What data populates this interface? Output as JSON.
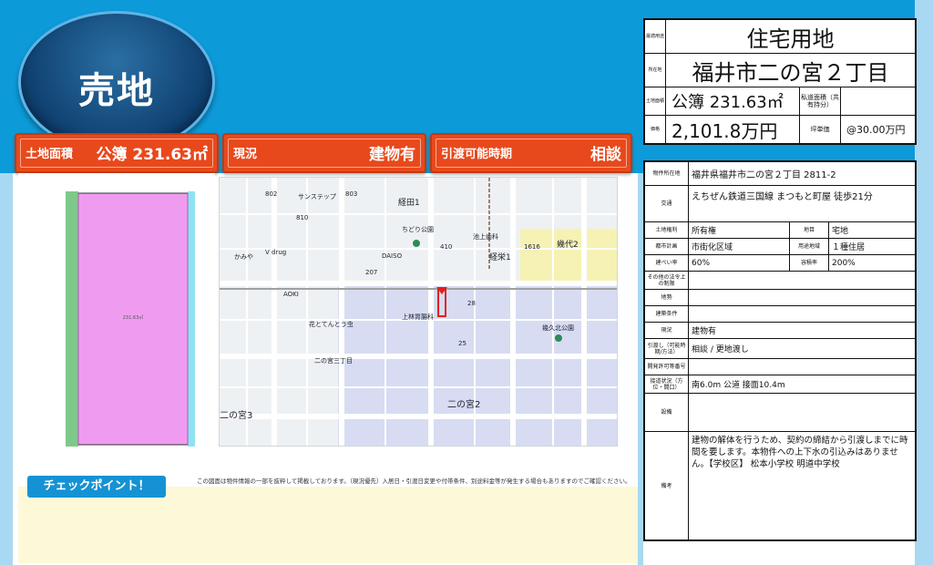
{
  "header": {
    "badge": "売地",
    "pills": [
      {
        "label": "土地面積",
        "value": "公簿 231.63㎡"
      },
      {
        "label": "現況",
        "value": "建物有"
      },
      {
        "label": "引渡可能時期",
        "value": "相談"
      }
    ]
  },
  "summary": {
    "use_label": "最適用途",
    "use": "住宅用地",
    "location_label": "所在地",
    "location": "福井市二の宮２丁目",
    "area_label": "土地面積",
    "area": "公簿 231.63㎡",
    "private_road_label": "私道面積（共有持分）",
    "private_road": "",
    "price_label": "価格",
    "price": "2,101.8万円",
    "tsubo_label": "坪単価",
    "tsubo": "@30.00万円"
  },
  "details": {
    "address_label": "物件所在地",
    "address": "福井県福井市二の宮２丁目 2811-2",
    "transport_label": "交通",
    "transport": "えちぜん鉄道三国線 まつもと町屋 徒歩21分",
    "rights_label": "土地権利",
    "rights": "所有権",
    "land_type_label": "地目",
    "land_type": "宅地",
    "city_plan_label": "都市計画",
    "city_plan": "市街化区域",
    "zoning_label": "用途地域",
    "zoning": "１種住居",
    "bcr_label": "建ぺい率",
    "bcr": "60%",
    "far_label": "容積率",
    "far": "200%",
    "other_limits_label": "その他の法令上の制限",
    "terrain_label": "地勢",
    "building_cond_label": "建築条件",
    "status_label": "現況",
    "status": "建物有",
    "handover_label": "引渡し（可能時期/方法）",
    "handover": "相談 / 更地渡し",
    "dev_permit_label": "開発許可等番号",
    "road_label": "接道状況（方位・間口）",
    "road": "南6.0m 公道 接面10.4m",
    "facilities_label": "設備",
    "remarks_label": "備考",
    "remarks": "建物の解体を行うため、契約の締結から引渡しまでに時間を要します。本物件への上下水の引込みはありません。【学校区】 松本小学校 明道中学校"
  },
  "check": {
    "button": "チェックポイント！",
    "disclaimer": "この図面は物件情報の一部を抜粋して掲載しております。（現況優先）入居日・引渡日変更や付帯条件、別途料金等が発生する場合もありますのでご確認ください。"
  },
  "map": {
    "labels": [
      "経田1",
      "ちどり公園",
      "池上歯科",
      "幾代2",
      "経栄1",
      "DAISO",
      "かみや",
      "V drug",
      "AOKI",
      "花とてんとう虫",
      "上林胃腸科",
      "幾久北公園",
      "二の宮2",
      "二の宮3",
      "二の宮三丁目",
      "サンステップ"
    ],
    "numbers": [
      "802",
      "803",
      "808",
      "810",
      "312",
      "417",
      "410",
      "407",
      "1616",
      "1507",
      "1504",
      "1413",
      "207",
      "28",
      "27",
      "25",
      "24",
      "20",
      "19",
      "17",
      "16",
      "14",
      "12",
      "39",
      "9",
      "4",
      "3"
    ]
  },
  "colors": {
    "sky": "#0d9ad9",
    "pill": "#e8491c",
    "plot": "#ef9cf0",
    "target": "#e02020"
  }
}
